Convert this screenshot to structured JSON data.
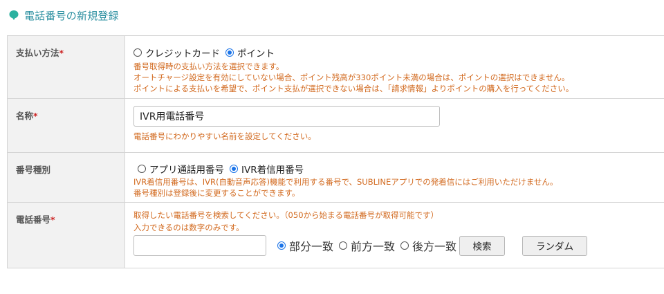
{
  "header": {
    "title": "電話番号の新規登録",
    "icon": "speech-pin-icon",
    "accent_color": "#2b8fa0"
  },
  "required_mark": "*",
  "payment": {
    "label": "支払い方法",
    "options": [
      {
        "label": "クレジットカード",
        "selected": false
      },
      {
        "label": "ポイント",
        "selected": true
      }
    ],
    "hints": [
      "番号取得時の支払い方法を選択できます。",
      "オートチャージ設定を有効にしていない場合、ポイント残高が330ポイント未満の場合は、ポイントの選択はできません。",
      "ポイントによる支払いを希望で、ポイント支払が選択できない場合は、「請求情報」よりポイントの購入を行ってください。"
    ]
  },
  "name": {
    "label": "名称",
    "value": "IVR用電話番号",
    "hint": "電話番号にわかりやすい名前を設定してください。"
  },
  "number_type": {
    "label": "番号種別",
    "options": [
      {
        "label": "アプリ通話用番号",
        "selected": false
      },
      {
        "label": "IVR着信用番号",
        "selected": true
      }
    ],
    "hints": [
      "IVR着信用番号は、IVR(自動音声応答)機能で利用する番号で、SUBLINEアプリでの発着信にはご利用いただけません。",
      "番号種別は登録後に変更することができます。"
    ]
  },
  "phone": {
    "label": "電話番号",
    "hints": [
      "取得したい電話番号を検索してください。（050から始まる電話番号が取得可能です）",
      "入力できるのは数字のみです。"
    ],
    "search_value": "",
    "match_options": [
      {
        "label": "部分一致",
        "selected": true
      },
      {
        "label": "前方一致",
        "selected": false
      },
      {
        "label": "後方一致",
        "selected": false
      }
    ],
    "search_button": "検索",
    "random_button": "ランダム"
  },
  "colors": {
    "hint": "#d2691e",
    "required": "#cc2222",
    "label_bg": "#f2f2f2",
    "radio_selected": "#1a73e8"
  }
}
